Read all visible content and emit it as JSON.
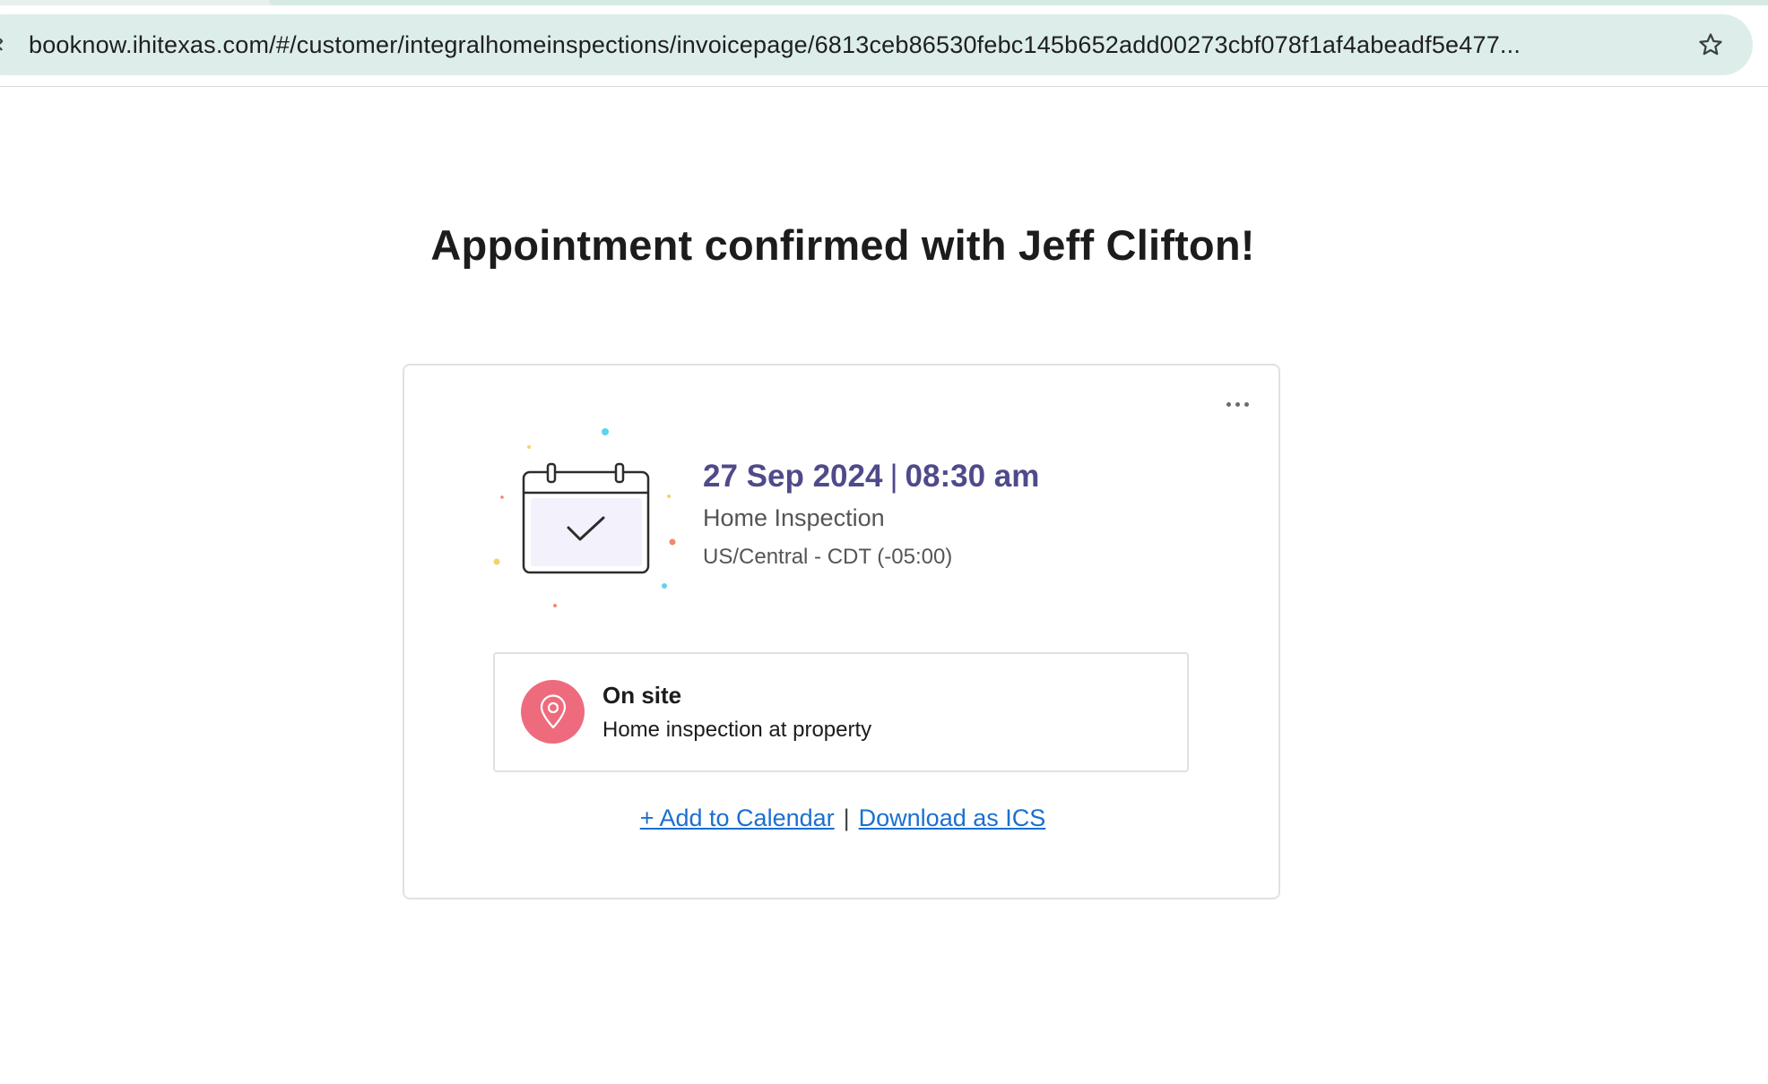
{
  "browser": {
    "url": "booknow.ihitexas.com/#/customer/integralhomeinspections/invoicepage/6813ceb86530febc145b652add00273cbf078f1af4abeadf5e477...",
    "bookmark_icon": "star-icon"
  },
  "page": {
    "title": "Appointment confirmed with Jeff Clifton!"
  },
  "appointment": {
    "date": "27 Sep 2024",
    "separator": "|",
    "time": "08:30 am",
    "service": "Home Inspection",
    "timezone": "US/Central - CDT (-05:00)",
    "illustration_icon": "calendar-check-icon",
    "more_icon": "more-horizontal-icon"
  },
  "location": {
    "title": "On site",
    "description": "Home inspection at property",
    "icon": "location-pin-icon",
    "icon_color": "#ee6b7e"
  },
  "actions": {
    "add_to_calendar": "+ Add to Calendar",
    "divider": "|",
    "download_ics": "Download as ICS"
  },
  "colors": {
    "accent_text": "#4f4a8a",
    "link": "#1a6fd1",
    "omnibox_bg": "#dcedea"
  }
}
